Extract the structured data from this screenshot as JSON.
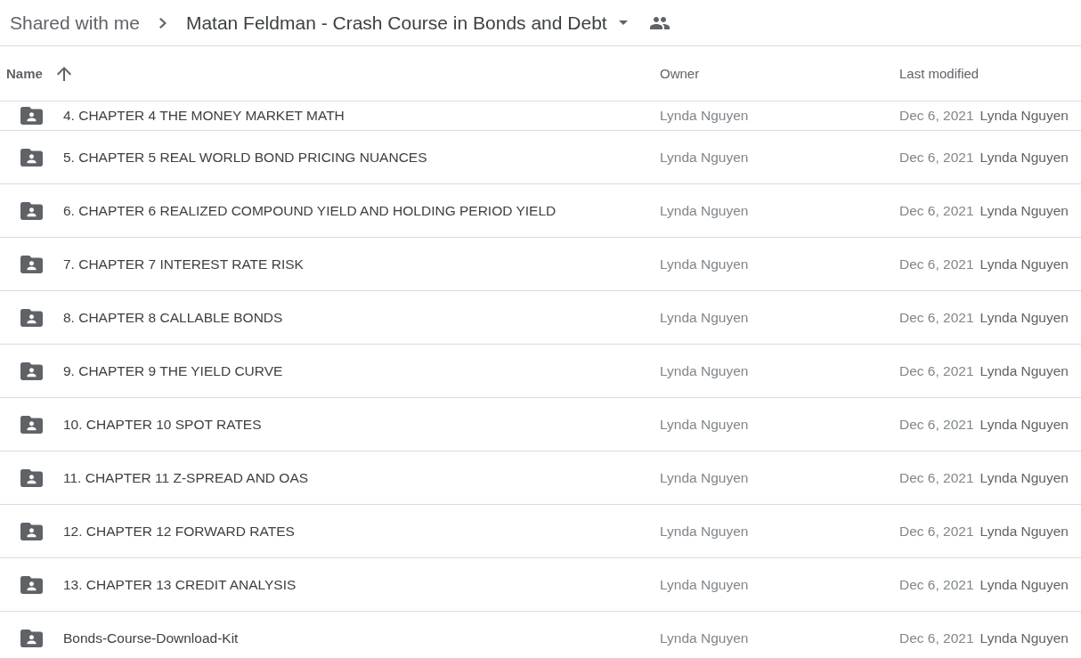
{
  "breadcrumb": {
    "parent": "Shared with me",
    "current": "Matan Feldman - Crash Course in Bonds and Debt"
  },
  "table": {
    "columns": [
      {
        "label": "Name",
        "sorted": true
      },
      {
        "label": "Owner",
        "sorted": false
      },
      {
        "label": "Last modified",
        "sorted": false
      }
    ],
    "rows": [
      {
        "name": "4. CHAPTER 4 THE MONEY MARKET MATH",
        "owner": "Lynda Nguyen",
        "date": "Dec 6, 2021",
        "modified_by": "Lynda Nguyen"
      },
      {
        "name": "5. CHAPTER 5 REAL WORLD BOND PRICING NUANCES",
        "owner": "Lynda Nguyen",
        "date": "Dec 6, 2021",
        "modified_by": "Lynda Nguyen"
      },
      {
        "name": "6. CHAPTER 6 REALIZED COMPOUND YIELD AND HOLDING PERIOD YIELD",
        "owner": "Lynda Nguyen",
        "date": "Dec 6, 2021",
        "modified_by": "Lynda Nguyen"
      },
      {
        "name": "7. CHAPTER 7 INTEREST RATE RISK",
        "owner": "Lynda Nguyen",
        "date": "Dec 6, 2021",
        "modified_by": "Lynda Nguyen"
      },
      {
        "name": "8. CHAPTER 8 CALLABLE BONDS",
        "owner": "Lynda Nguyen",
        "date": "Dec 6, 2021",
        "modified_by": "Lynda Nguyen"
      },
      {
        "name": "9. CHAPTER 9 THE YIELD CURVE",
        "owner": "Lynda Nguyen",
        "date": "Dec 6, 2021",
        "modified_by": "Lynda Nguyen"
      },
      {
        "name": "10. CHAPTER 10 SPOT RATES",
        "owner": "Lynda Nguyen",
        "date": "Dec 6, 2021",
        "modified_by": "Lynda Nguyen"
      },
      {
        "name": "11. CHAPTER 11 Z-SPREAD AND OAS",
        "owner": "Lynda Nguyen",
        "date": "Dec 6, 2021",
        "modified_by": "Lynda Nguyen"
      },
      {
        "name": "12. CHAPTER 12 FORWARD RATES",
        "owner": "Lynda Nguyen",
        "date": "Dec 6, 2021",
        "modified_by": "Lynda Nguyen"
      },
      {
        "name": "13. CHAPTER 13 CREDIT ANALYSIS",
        "owner": "Lynda Nguyen",
        "date": "Dec 6, 2021",
        "modified_by": "Lynda Nguyen"
      },
      {
        "name": "Bonds-Course-Download-Kit",
        "owner": "Lynda Nguyen",
        "date": "Dec 6, 2021",
        "modified_by": "Lynda Nguyen"
      }
    ]
  }
}
